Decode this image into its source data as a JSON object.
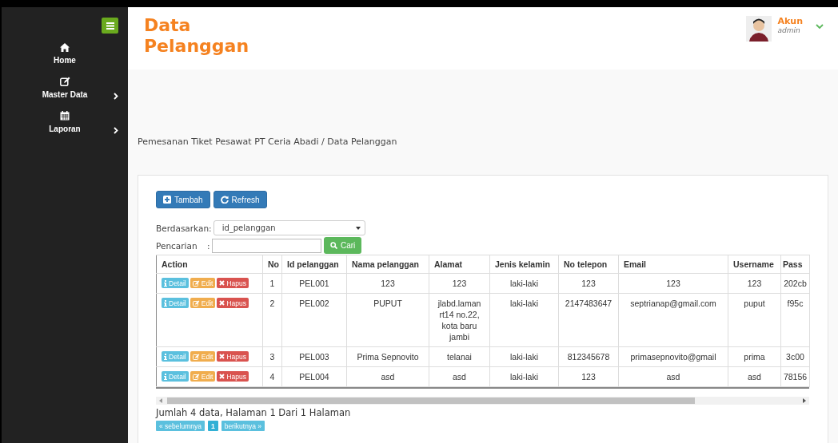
{
  "sidebar": {
    "items": [
      {
        "label": "Home",
        "has_submenu": false
      },
      {
        "label": "Master Data",
        "has_submenu": true
      },
      {
        "label": "Laporan",
        "has_submenu": true
      }
    ]
  },
  "header": {
    "title": "Data Pelanggan",
    "user": {
      "name": "Akun",
      "role": "admin"
    }
  },
  "breadcrumb": "Pemesanan Tiket Pesawat PT Ceria Abadi / Data Pelanggan",
  "toolbar": [
    {
      "label": "Tambah",
      "kind": "add"
    },
    {
      "label": "Refresh",
      "kind": "refresh"
    }
  ],
  "filter": {
    "label": "Berdasarkan:",
    "value": "id_pelanggan"
  },
  "search": {
    "label": "Pencarian",
    "separator": ":",
    "button": "Cari"
  },
  "table": {
    "columns": [
      "Action",
      "No",
      "Id pelanggan",
      "Nama pelanggan",
      "Alamat",
      "Jenis kelamin",
      "No telepon",
      "Email",
      "Username",
      "Pass"
    ],
    "rows": [
      {
        "cells": [
          {
            "buttons": [
              "Detail",
              "Edit",
              "Hapus"
            ]
          },
          "1",
          "PEL001",
          "123",
          "123",
          "laki-laki",
          "123",
          "123",
          "123",
          "202cb"
        ]
      },
      {
        "cells": [
          {
            "buttons": [
              "Detail",
              "Edit",
              "Hapus"
            ]
          },
          "2",
          "PEL002",
          "PUPUT",
          "jlabd.laman rt14 no.22, kota baru jambi",
          "laki-laki",
          "2147483647",
          "septrianap@gmail.com",
          "puput",
          "f95c"
        ]
      },
      {
        "cells": [
          {
            "buttons": [
              "Detail",
              "Edit",
              "Hapus"
            ]
          },
          "3",
          "PEL003",
          "Prima Sepnovito",
          "telanai",
          "laki-laki",
          "812345678",
          "primasepnovito@gmail",
          "prima",
          "3c00"
        ]
      },
      {
        "cells": [
          {
            "buttons": [
              "Detail",
              "Edit",
              "Hapus"
            ]
          },
          "4",
          "PEL004",
          "asd",
          "asd",
          "laki-laki",
          "123",
          "asd",
          "asd",
          "78156"
        ]
      }
    ]
  },
  "summary": "Jumlah 4 data, Halaman 1 Dari 1 Halaman",
  "pagination": [
    {
      "label": "« sebelumnya",
      "selected": false
    },
    {
      "label": "1",
      "selected": true
    },
    {
      "label": "berikutnya »",
      "selected": false
    }
  ]
}
